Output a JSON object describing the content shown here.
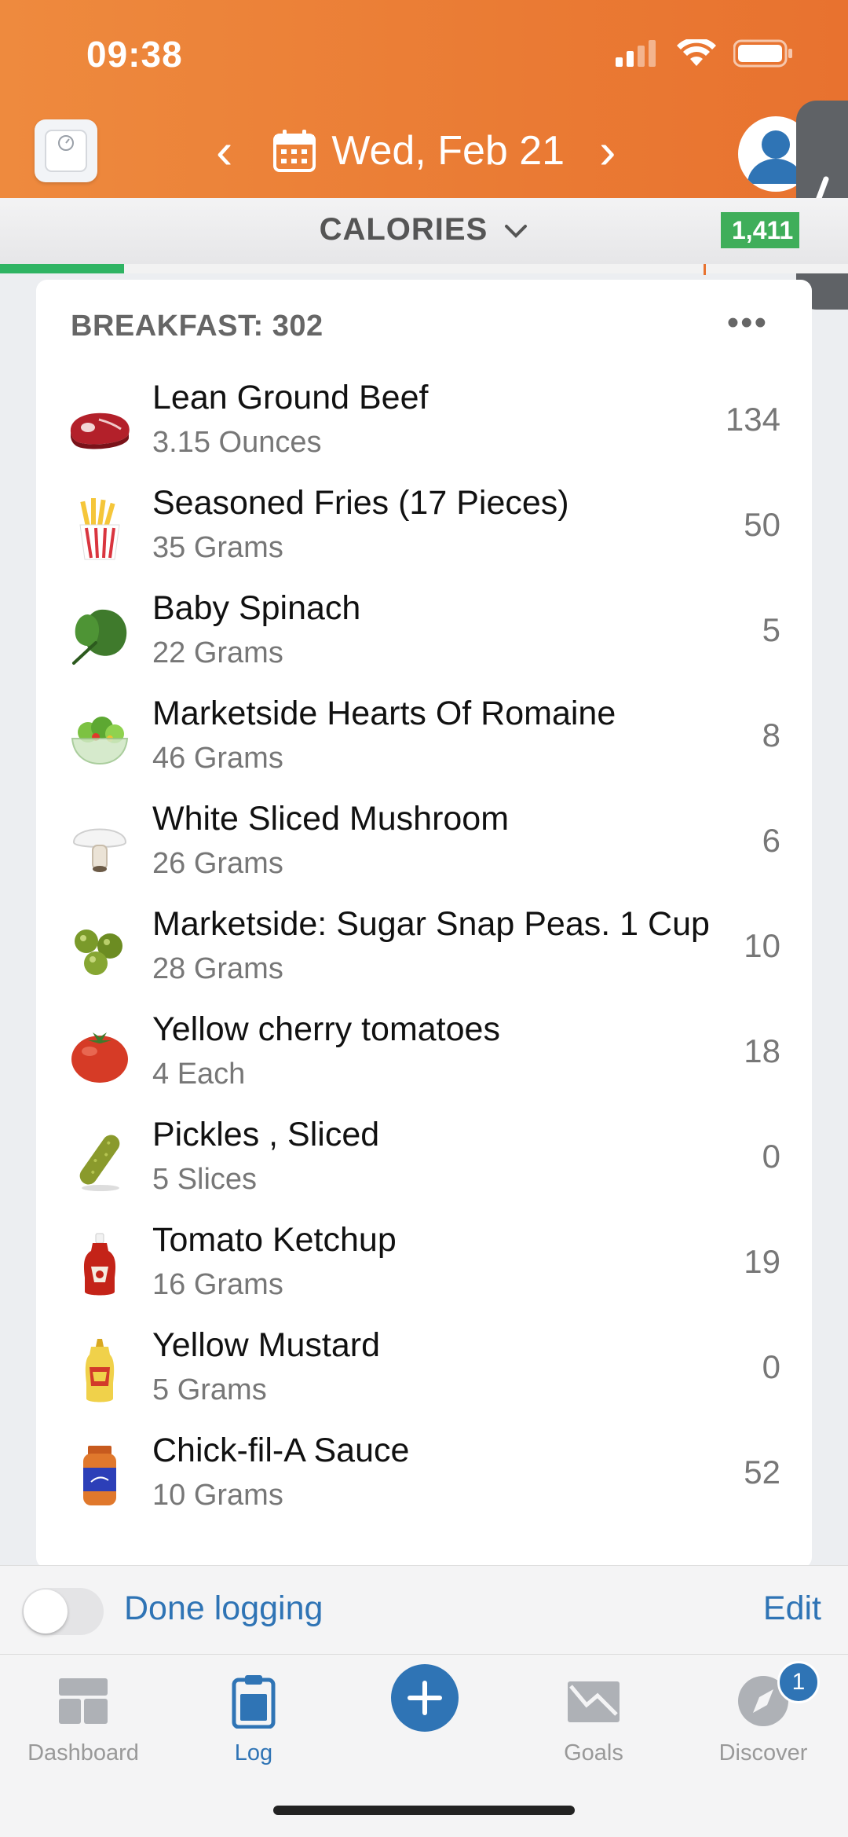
{
  "status_bar": {
    "time": "09:38"
  },
  "header": {
    "date": "Wed, Feb 21"
  },
  "calorie_bar": {
    "label": "CALORIES",
    "badge": "1,411",
    "progress_fraction": 0.146
  },
  "meal": {
    "title": "BREAKFAST: 302",
    "items": [
      {
        "name": "Lean Ground Beef",
        "qty": "3.15 Ounces",
        "cals": "134",
        "icon": "steak-icon"
      },
      {
        "name": "Seasoned Fries (17 Pieces)",
        "qty": "35 Grams",
        "cals": "50",
        "icon": "fries-icon"
      },
      {
        "name": "Baby Spinach",
        "qty": "22 Grams",
        "cals": "5",
        "icon": "spinach-icon"
      },
      {
        "name": "Marketside Hearts Of Romaine",
        "qty": "46 Grams",
        "cals": "8",
        "icon": "salad-icon"
      },
      {
        "name": "White Sliced Mushroom",
        "qty": "26 Grams",
        "cals": "6",
        "icon": "mushroom-icon"
      },
      {
        "name": "Marketside: Sugar Snap Peas. 1 Cup",
        "qty": "28 Grams",
        "cals": "10",
        "icon": "peas-icon"
      },
      {
        "name": "Yellow cherry tomatoes",
        "qty": "4 Each",
        "cals": "18",
        "icon": "tomato-icon"
      },
      {
        "name": "Pickles , Sliced",
        "qty": "5 Slices",
        "cals": "0",
        "icon": "pickle-icon"
      },
      {
        "name": "Tomato Ketchup",
        "qty": "16 Grams",
        "cals": "19",
        "icon": "ketchup-icon"
      },
      {
        "name": "Yellow Mustard",
        "qty": "5 Grams",
        "cals": "0",
        "icon": "mustard-icon"
      },
      {
        "name": "Chick-fil-A Sauce",
        "qty": "10 Grams",
        "cals": "52",
        "icon": "sauce-jar-icon"
      }
    ]
  },
  "footer": {
    "done_label": "Done logging",
    "edit_label": "Edit"
  },
  "tabs": {
    "dashboard": "Dashboard",
    "log": "Log",
    "goals": "Goals",
    "discover": "Discover",
    "discover_badge": "1"
  },
  "colors": {
    "header": "#ea7b34",
    "accent": "#2f74b5",
    "green": "#3fae5a"
  }
}
